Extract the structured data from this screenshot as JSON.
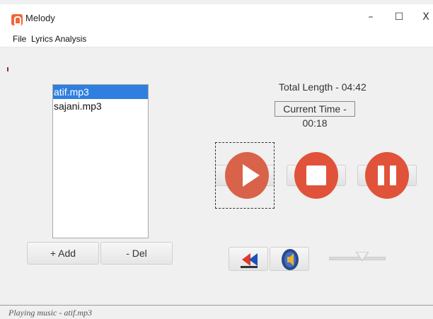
{
  "window": {
    "title": "Melody",
    "minimize_glyph": "–",
    "maximize_glyph": "☐",
    "close_glyph": "X"
  },
  "menu": {
    "items": [
      "File",
      "Lyrics Analysis"
    ]
  },
  "playlist": {
    "items": [
      {
        "label": "atif.mp3",
        "selected": true
      },
      {
        "label": "sajani.mp3",
        "selected": false
      }
    ],
    "add_label": "+ Add",
    "del_label": "- Del"
  },
  "info": {
    "total_length": "Total Length - 04:42",
    "current_time": "Current Time - 00:18"
  },
  "controls": {
    "play_icon": "play-icon",
    "stop_icon": "stop-icon",
    "pause_icon": "pause-icon",
    "rewind_icon": "rewind-icon",
    "volume_icon": "speaker-icon",
    "volume_level": 0.5
  },
  "status": {
    "text": "Playing music - atif.mp3"
  },
  "colors": {
    "accent": "#e0533a",
    "selection": "#2f7fe0"
  }
}
